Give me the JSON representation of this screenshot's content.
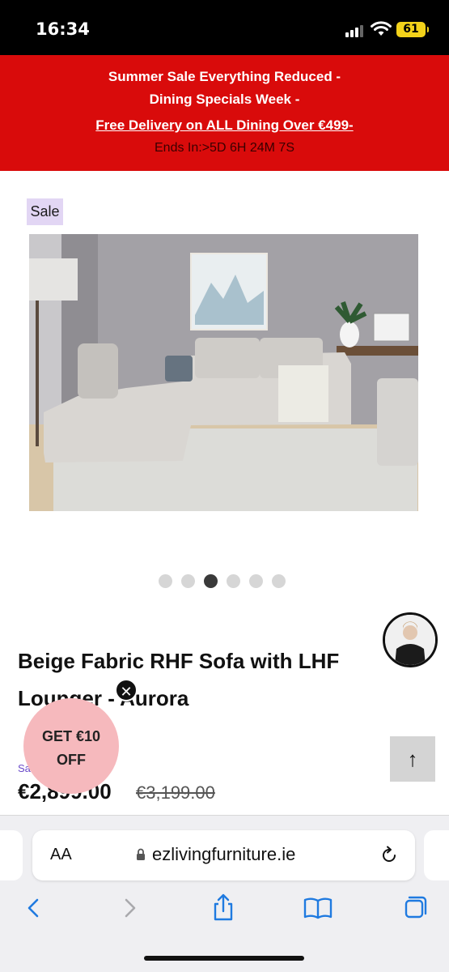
{
  "status_bar": {
    "time": "16:34",
    "battery": "61"
  },
  "promo": {
    "line1": "Summer Sale Everything Reduced -",
    "line2": "Dining Specials Week -",
    "link": "Free Delivery on ALL Dining Over €499-",
    "timer": "Ends In:>5D 6H 24M 7S"
  },
  "product": {
    "badge": "Sale",
    "title_line1": "Beige Fabric RHF Sofa with LHF",
    "title_line2": "Lounger - Aurora",
    "sale_label": "Sa",
    "price": "€2,899.00",
    "old_price": "€3,199.00",
    "gallery": {
      "count": 6,
      "active_index": 2
    }
  },
  "offer": {
    "line1": "GET €10",
    "line2": "OFF"
  },
  "browser": {
    "text_size_label": "AA",
    "url": "ezlivingfurniture.ie"
  },
  "colors": {
    "promo_bg": "#d90b0b",
    "badge_bg": "#e2d6f4",
    "offer_bg": "#f6b9bd",
    "ios_blue": "#1f7ae0"
  },
  "icons": [
    "signal-icon",
    "wifi-icon",
    "battery-icon",
    "close-icon",
    "arrow-up-icon",
    "lock-icon",
    "reload-icon",
    "back-icon",
    "forward-icon",
    "share-icon",
    "bookmarks-icon",
    "tabs-icon"
  ]
}
